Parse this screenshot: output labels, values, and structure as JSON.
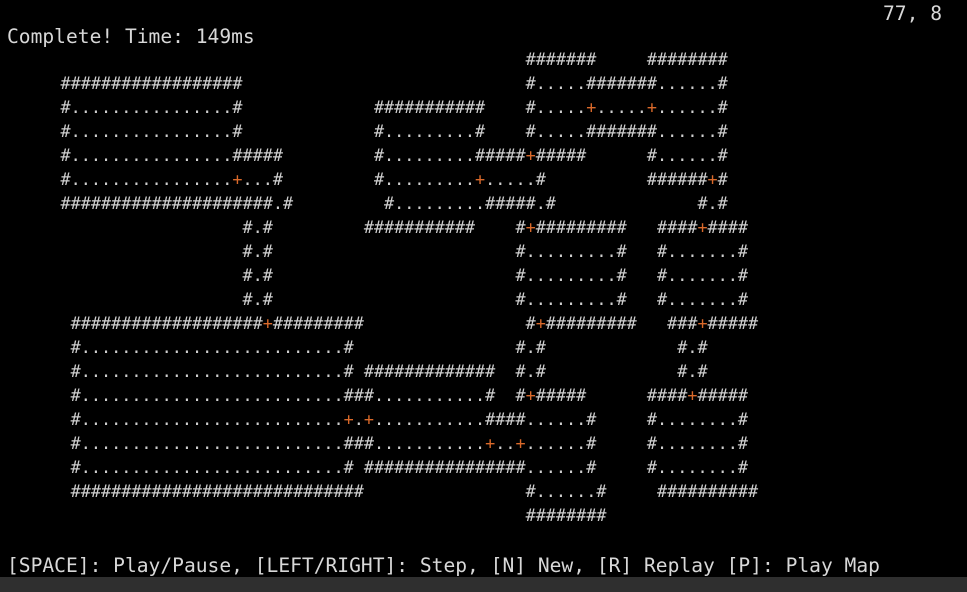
{
  "status_text": "Complete! Time: 149ms",
  "cursor_position": "77, 8",
  "help_text": "[SPACE]: Play/Pause, [LEFT/RIGHT]: Step, [N] New, [R] Replay [P]: Play Map",
  "colors": {
    "background": "#000000",
    "text": "#d8d8d8",
    "wall": "#cfcfcf",
    "door": "#d9692a"
  },
  "map_rows": [
    "                                                   #######     ########",
    "     ##################                            #.....#######......#",
    "     #................#             ###########    #.....+.....+......#",
    "     #................#             #.........#    #.....#######......#",
    "     #................#####         #.........#####+#####      #......#",
    "     #................+...#         #.........+.....#          ######+#",
    "     #####################.#         #.........#####.#              #.#",
    "                       #.#         ###########    #+#########   ####+####",
    "                       #.#                        #.........#   #.......#",
    "                       #.#                        #.........#   #.......#",
    "                       #.#                        #.........#   #.......#",
    "      ###################+#########                #+#########   ###+#####",
    "      #..........................#                #.#             #.#",
    "      #..........................# #############  #.#             #.#",
    "      #..........................###...........#  #+#####      ####+#####",
    "      #..........................+.+...........####......#     #........#",
    "      #..........................###...........+..+......#     #........#",
    "      #..........................# ################......#     #........#",
    "      #############################                #......#     ##########",
    "                                                   ########"
  ]
}
